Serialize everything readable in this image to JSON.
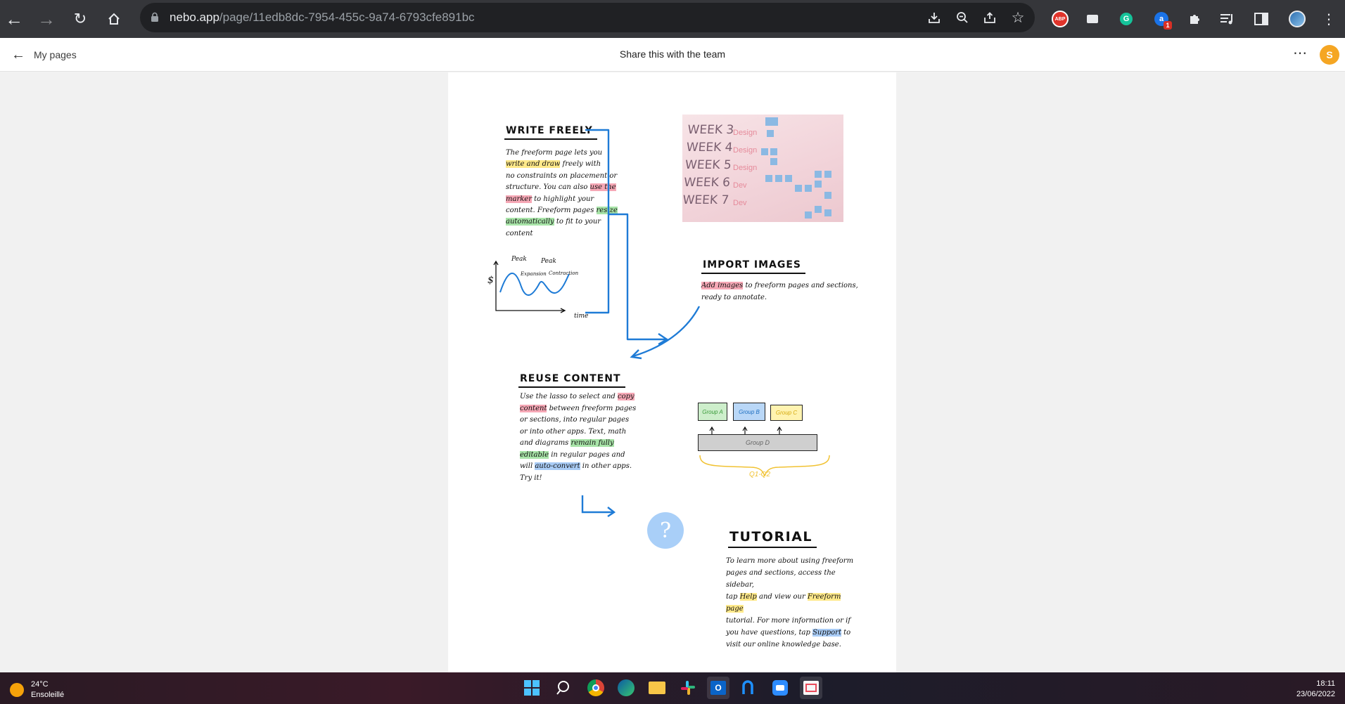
{
  "browser": {
    "url_host": "nebo.app",
    "url_path": "/page/11edb8dc-7954-455c-9a74-6793cfe891bc",
    "extensions": [
      "abp-icon",
      "briefcase-icon",
      "grammarly-icon",
      "translate-icon",
      "puzzle-icon",
      "media-icon",
      "sidepanel-icon",
      "profile-icon",
      "kebab-icon"
    ],
    "badge": "1"
  },
  "header": {
    "back_label": "My pages",
    "title": "Share this with the team",
    "avatar_initial": "S"
  },
  "sections": {
    "write": {
      "title": "WRITE FREELY",
      "lines": [
        [
          "The freeform page lets you"
        ],
        [
          "write and draw freely with"
        ],
        [
          "no constraints on placement or"
        ],
        [
          "structure. You can also use the"
        ],
        [
          "marker to highlight your"
        ],
        [
          "content. Freeform pages resize"
        ],
        [
          "automatically to fit to your"
        ],
        [
          "content"
        ]
      ]
    },
    "graph": {
      "peak1": "Peak",
      "peak2": "Peak",
      "expansion": "Expansion",
      "contraction": "Contraction",
      "ylabel": "$",
      "xlabel": "time"
    },
    "photo": {
      "weeks": [
        "WEEK 3",
        "WEEK 4",
        "WEEK 5",
        "WEEK 6",
        "WEEK 7"
      ],
      "side": [
        "Design",
        "Design",
        "Design",
        "Dev",
        "Dev"
      ]
    },
    "import": {
      "title": "IMPORT IMAGES",
      "line1_hl": "Add images",
      "line1": " to freeform pages and sections,",
      "line2": "ready to annotate."
    },
    "reuse": {
      "title": "REUSE CONTENT",
      "l1a": "Use the lasso to select and ",
      "l1b": "copy",
      "l2a": "content",
      "l2b": " between freeform pages",
      "l3": "or sections, into regular pages",
      "l4": "or into other apps. Text, math",
      "l5a": "and diagrams ",
      "l5b": "remain fully",
      "l6a": "editable",
      "l6b": " in regular pages and",
      "l7a": "will ",
      "l7b": "auto-convert",
      "l7c": " in other apps.",
      "l8": "Try it!"
    },
    "diagram": {
      "group_a": "Group A",
      "group_b": "Group B",
      "group_c": "Group C",
      "group_d": "Group D",
      "brace_label": "Q1-Q2"
    },
    "help": {
      "symbol": "?"
    },
    "tutorial": {
      "title": "TUTORIAL",
      "l1": "To learn more about using freeform",
      "l2": "pages and sections, access the sidebar,",
      "l3a": "tap ",
      "l3b": "Help",
      "l3c": " and view our ",
      "l3d": "Freeform page",
      "l4": "tutorial. For more information or if",
      "l5a": "you have questions, tap ",
      "l5b": "Support",
      "l5c": " to",
      "l6": "visit our online knowledge base."
    }
  },
  "taskbar": {
    "temp": "24°C",
    "condition": "Ensoleillé",
    "time": "18:11",
    "date": "23/06/2022"
  }
}
